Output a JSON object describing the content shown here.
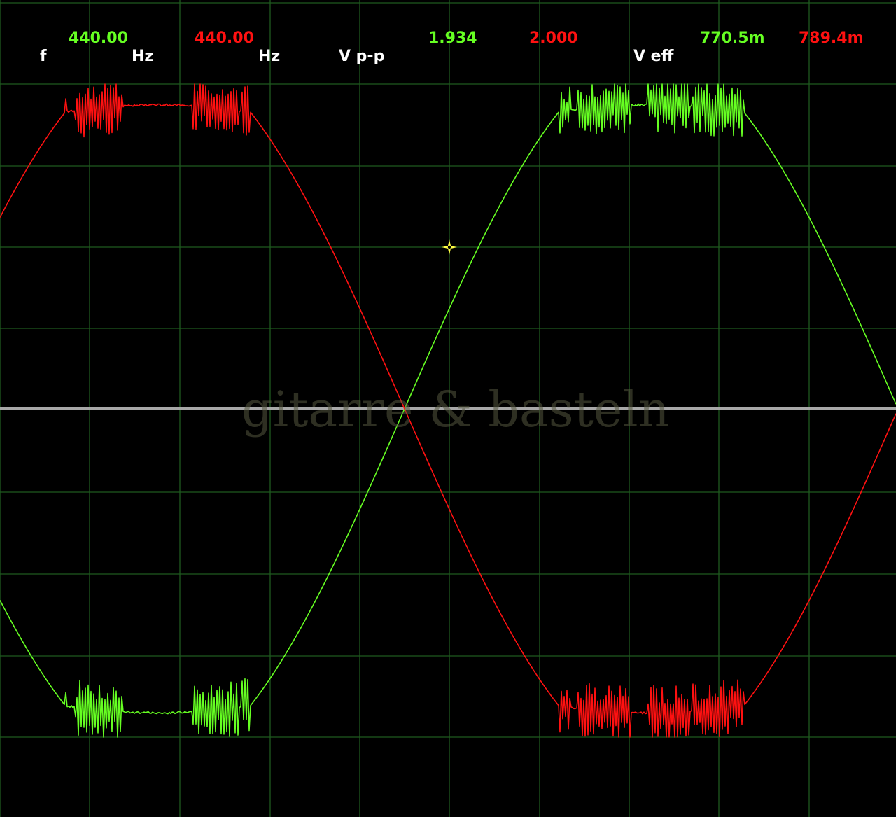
{
  "readouts": {
    "freq_label": "f",
    "ch1_freq": "440.00",
    "ch1_freq_unit": "Hz",
    "ch2_freq": "440.00",
    "ch2_freq_unit": "Hz",
    "vpp_label": "V p-p",
    "ch1_vpp": "1.934",
    "ch2_vpp": "2.000",
    "veff_label": "V eff",
    "ch1_veff": "770.5m",
    "ch2_veff": "789.4m"
  },
  "watermark": "gitarre & basteln",
  "colors": {
    "background": "#000000",
    "grid": "#1f5a1f",
    "baseline": "#a8a8a8",
    "channel1": "#66ff22",
    "channel2": "#ff1111",
    "cursor": "#ffff44",
    "label": "#ffffff"
  },
  "icons": {
    "cursor": "crosshair-marker-icon"
  }
}
